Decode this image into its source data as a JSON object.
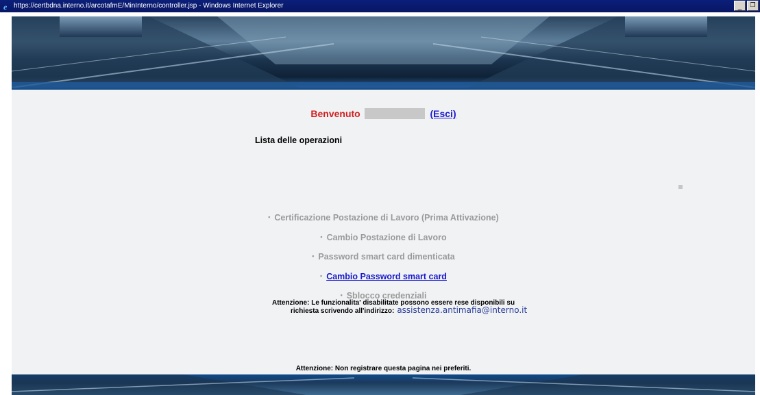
{
  "window": {
    "title": "https://certbdna.interno.it/arcotafmE/MinInterno/controller.jsp - Windows Internet Explorer",
    "minimize_label": "_",
    "restore_label": "🗗"
  },
  "header": {
    "welcome_label": "Benvenuto",
    "logout_link": "(Esci)"
  },
  "main": {
    "section_title": "Lista delle operazioni",
    "operations": [
      {
        "label": "Certificazione Postazione di Lavoro (Prima Attivazione)",
        "enabled": false
      },
      {
        "label": "Cambio Postazione di Lavoro",
        "enabled": false
      },
      {
        "label": "Password smart card dimenticata",
        "enabled": false
      },
      {
        "label": "Cambio Password smart card",
        "enabled": true
      },
      {
        "label": "Sblocco credenziali",
        "enabled": false
      }
    ],
    "bullet": "•",
    "notice_line1": "Attenzione: Le funzionalita' disabilitate possono essere rese disponibili su",
    "notice_line2": "richiesta scrivendo all'indirizzo:",
    "support_email": "assistenza.antimafia@interno.it",
    "footer_notice": "Attenzione: Non registrare questa pagina nei preferiti."
  },
  "colors": {
    "welcome": "#d21f1f",
    "link": "#1a1acc",
    "disabled": "#9a9a9a",
    "titlebar": "#0b1f7a"
  }
}
